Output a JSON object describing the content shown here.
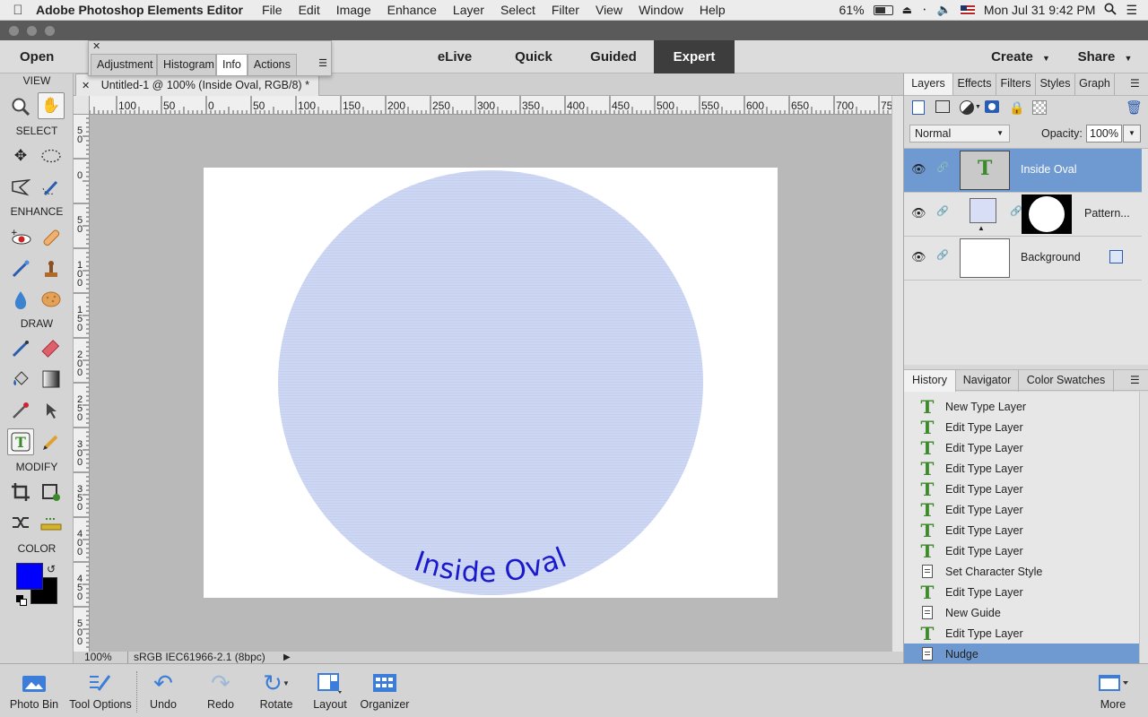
{
  "menubar": {
    "app_name": "Adobe Photoshop Elements Editor",
    "items": [
      "File",
      "Edit",
      "Image",
      "Enhance",
      "Layer",
      "Select",
      "Filter",
      "View",
      "Window",
      "Help"
    ],
    "battery": "61%",
    "datetime": "Mon Jul 31  9:42 PM"
  },
  "topbar": {
    "open_label": "Open",
    "modes": [
      "eLive",
      "Quick",
      "Guided",
      "Expert"
    ],
    "active_mode": "Expert",
    "create_label": "Create",
    "share_label": "Share"
  },
  "float_panel": {
    "tabs": [
      "Adjustment",
      "Histogram",
      "Info",
      "Actions"
    ],
    "active_tab": "Info"
  },
  "toolbar": {
    "sections": {
      "view": "VIEW",
      "select": "SELECT",
      "enhance": "ENHANCE",
      "draw": "DRAW",
      "modify": "MODIFY",
      "color": "COLOR"
    },
    "foreground_color": "#0000ff",
    "background_color": "#000000"
  },
  "document": {
    "tab_title": "Untitled-1 @ 100% (Inside Oval, RGB/8) *",
    "text": "Inside Oval",
    "text_color": "#1a1acc",
    "oval_color": "#cdd7f3",
    "zoom": "100%",
    "color_profile": "sRGB IEC61966-2.1 (8bpc)"
  },
  "ruler": {
    "h_labels": [
      "100",
      "50",
      "0",
      "50",
      "100",
      "150",
      "200",
      "250",
      "300",
      "350",
      "400",
      "450",
      "500",
      "550",
      "600",
      "650",
      "700",
      "75"
    ],
    "v_labels": [
      "5\n0",
      "0",
      "5\n0",
      "1\n0\n0",
      "1\n5\n0",
      "2\n0\n0",
      "2\n5\n0",
      "3\n0\n0",
      "3\n5\n0",
      "4\n0\n0",
      "4\n5\n0",
      "5\n0\n0"
    ]
  },
  "layers_panel": {
    "tabs": [
      "Layers",
      "Effects",
      "Filters",
      "Styles",
      "Graph"
    ],
    "active_tab": "Layers",
    "blend_mode": "Normal",
    "opacity_label": "Opacity:",
    "opacity": "100%",
    "layers": [
      {
        "name": "Inside Oval",
        "selected": true
      },
      {
        "name": "Pattern...",
        "selected": false
      },
      {
        "name": "Background",
        "selected": false
      }
    ]
  },
  "history_panel": {
    "tabs": [
      "History",
      "Navigator",
      "Color Swatches"
    ],
    "active_tab": "History",
    "items": [
      {
        "label": "New Type Layer",
        "icon": "type"
      },
      {
        "label": "Edit Type Layer",
        "icon": "type"
      },
      {
        "label": "Edit Type Layer",
        "icon": "type"
      },
      {
        "label": "Edit Type Layer",
        "icon": "type"
      },
      {
        "label": "Edit Type Layer",
        "icon": "type"
      },
      {
        "label": "Edit Type Layer",
        "icon": "type"
      },
      {
        "label": "Edit Type Layer",
        "icon": "type"
      },
      {
        "label": "Edit Type Layer",
        "icon": "type"
      },
      {
        "label": "Set Character Style",
        "icon": "doc"
      },
      {
        "label": "Edit Type Layer",
        "icon": "type"
      },
      {
        "label": "New Guide",
        "icon": "doc"
      },
      {
        "label": "Edit Type Layer",
        "icon": "type"
      },
      {
        "label": "Nudge",
        "icon": "doc",
        "selected": true
      }
    ]
  },
  "bottombar": {
    "photo_bin": "Photo Bin",
    "tool_options": "Tool Options",
    "undo": "Undo",
    "redo": "Redo",
    "rotate": "Rotate",
    "layout": "Layout",
    "organizer": "Organizer",
    "more": "More"
  }
}
